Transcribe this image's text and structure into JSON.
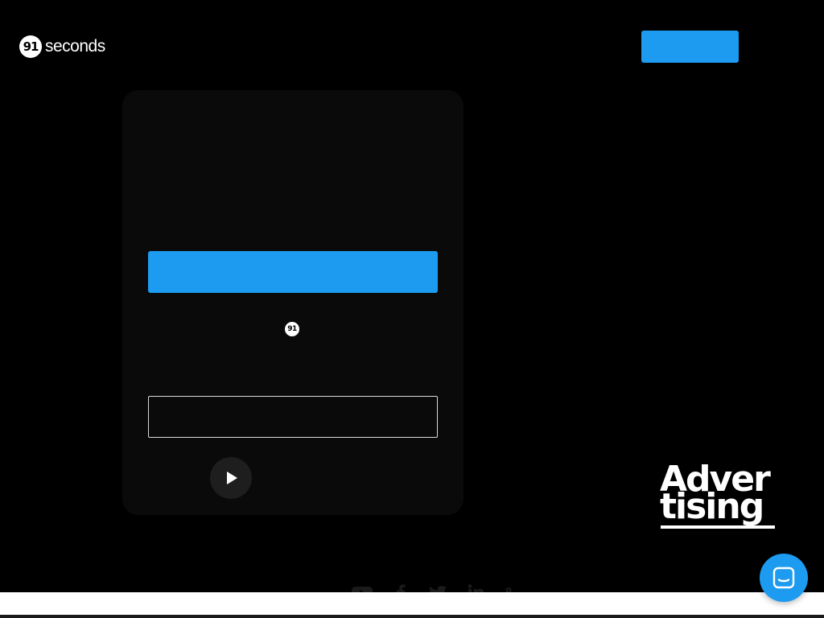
{
  "header": {
    "logo_mark": "91",
    "logo_word": "seconds",
    "cta_label": ""
  },
  "card": {
    "primary_button_label": "",
    "mark": "91",
    "input_value": "",
    "input_placeholder": ""
  },
  "advert": {
    "line1": "Adver",
    "line2": "tising"
  },
  "social": {
    "icons": [
      "youtube-icon",
      "facebook-icon",
      "twitter-icon",
      "linkedin-icon",
      "location-pin-icon"
    ]
  },
  "chat": {
    "icon": "chat-icon"
  },
  "colors": {
    "accent": "#1d9bf0",
    "background": "#000000",
    "card": "#0a0a0a"
  }
}
